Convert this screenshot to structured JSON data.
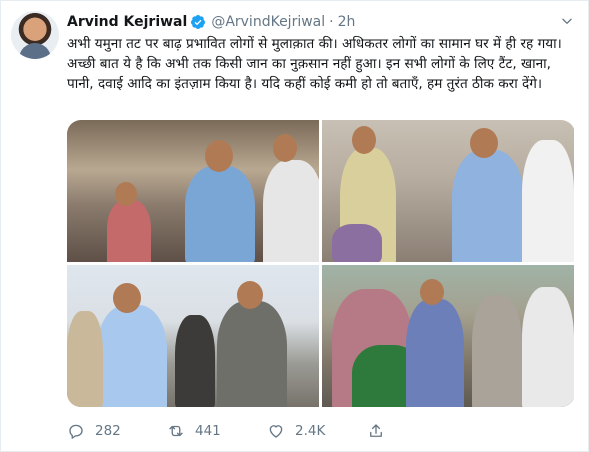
{
  "tweet": {
    "author_name": "Arvind Kejriwal",
    "handle": "@ArvindKejriwal",
    "separator": "·",
    "time": "2h",
    "text": "अभी यमुना तट पर बाढ़ प्रभावित लोगों से मुलाक़ात की। अधिकतर लोगों का सामान घर में ही रह गया। अच्छी बात ये है कि अभी तक किसी जान का नुक़सान नहीं हुआ। इन सभी लोगों के लिए टैंट, खाना, पानी, दवाई आदि का इंतज़ाम किया है। यदि कहीं कोई कमी हो तो बताएँ, हम तुरंत ठीक करा देंगे।",
    "verified": true
  },
  "stats": {
    "replies": "282",
    "retweets": "441",
    "likes": "2.4K"
  },
  "icons": {
    "verified": "verified-badge-icon",
    "menu": "chevron-down-icon",
    "reply": "reply-icon",
    "retweet": "retweet-icon",
    "like": "heart-icon",
    "share": "share-icon"
  },
  "colors": {
    "verified_blue": "#1da1f2",
    "secondary_text": "#657786",
    "primary_text": "#14171a"
  }
}
